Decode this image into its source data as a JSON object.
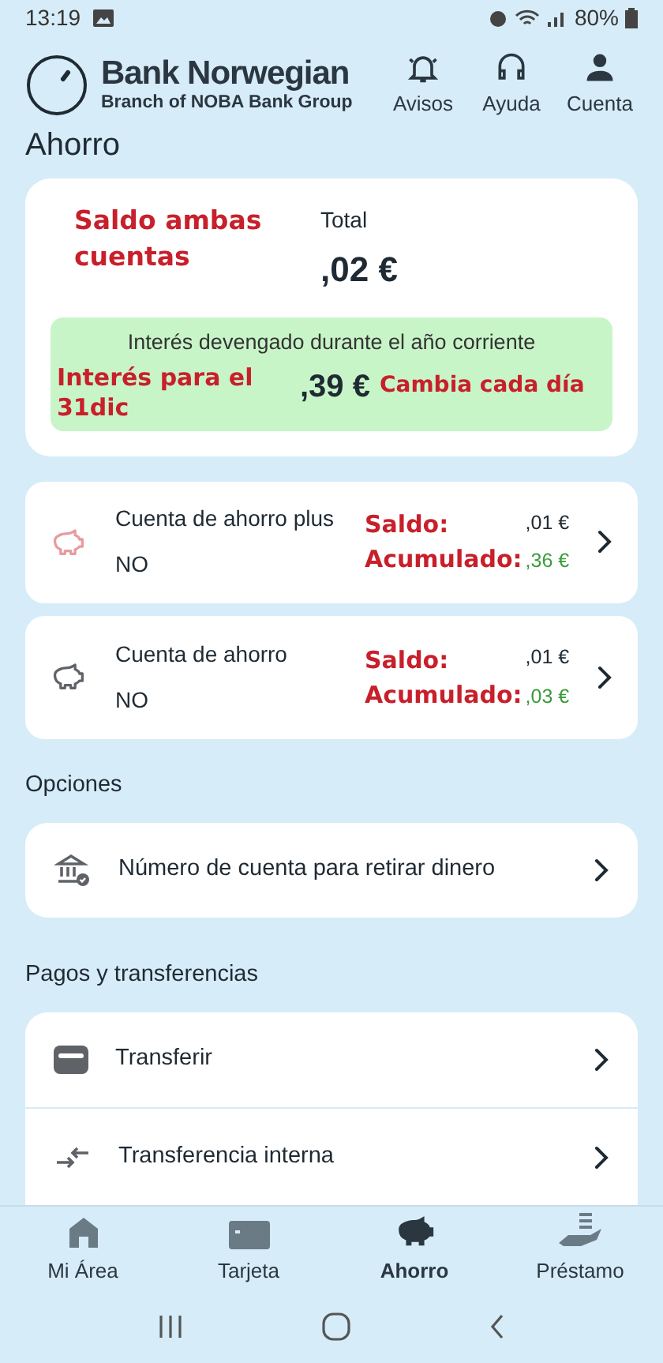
{
  "status_bar": {
    "time": "13:19",
    "battery": "80%"
  },
  "header": {
    "brand": "Bank Norwegian",
    "subtitle": "Branch of NOBA Bank Group",
    "actions": [
      {
        "kind": "bell",
        "label": "Avisos"
      },
      {
        "kind": "headset",
        "label": "Ayuda"
      },
      {
        "kind": "person",
        "label": "Cuenta"
      }
    ]
  },
  "page_title": "Ahorro",
  "summary": {
    "annotation": "Saldo ambas cuentas",
    "total_label": "Total",
    "total": ",02 €",
    "interest_label": "Interés devengado durante el año corriente",
    "interest_annotation": "Interés para el 31dic",
    "interest": ",39 €",
    "interest_note": "Cambia cada día"
  },
  "accounts": [
    {
      "name": "Cuenta de ahorro plus",
      "subtitle": "NO",
      "color": "#e89aa0",
      "balance_annotation": "Saldo:",
      "balance": ",01 €",
      "accrued_annotation": "Acumulado:",
      "accrued": ",36 €"
    },
    {
      "name": "Cuenta de ahorro",
      "subtitle": "NO",
      "color": "#5f6368",
      "balance_annotation": "Saldo:",
      "balance": ",01 €",
      "accrued_annotation": "Acumulado:",
      "accrued": ",03 €"
    }
  ],
  "options": {
    "title": "Opciones",
    "items": [
      {
        "kind": "bank",
        "label": "Número de cuenta para retirar dinero"
      }
    ]
  },
  "payments": {
    "title": "Pagos y transferencias",
    "items": [
      {
        "kind": "wallet",
        "label": "Transferir"
      },
      {
        "kind": "arrows",
        "label": "Transferencia interna"
      }
    ]
  },
  "bottom_nav": [
    {
      "kind": "home",
      "label": "Mi Área",
      "selected": false
    },
    {
      "kind": "card",
      "label": "Tarjeta",
      "selected": false
    },
    {
      "kind": "piggy",
      "label": "Ahorro",
      "selected": true
    },
    {
      "kind": "loan",
      "label": "Préstamo",
      "selected": false
    }
  ]
}
